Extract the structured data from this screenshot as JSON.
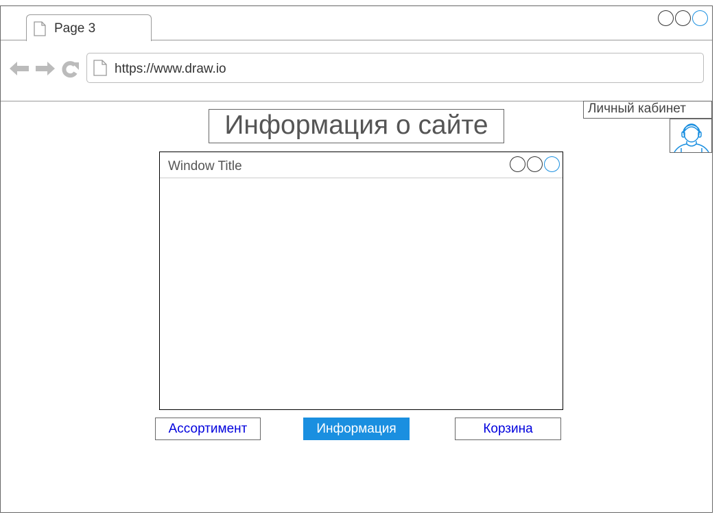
{
  "browser": {
    "tab_label": "Page 3",
    "url": "https://www.draw.io",
    "icons": [
      "back-arrow-icon",
      "forward-arrow-icon",
      "reload-icon",
      "page-icon"
    ],
    "accent_color": "#1a8fe0"
  },
  "page": {
    "title": "Информация о сайте"
  },
  "account": {
    "label": "Личный кабинет",
    "icon": "user-avatar-icon"
  },
  "window": {
    "title": "Window Title"
  },
  "nav": {
    "assortment": "Ассортимент",
    "information": "Информация",
    "cart": "Корзина",
    "active": "information"
  }
}
